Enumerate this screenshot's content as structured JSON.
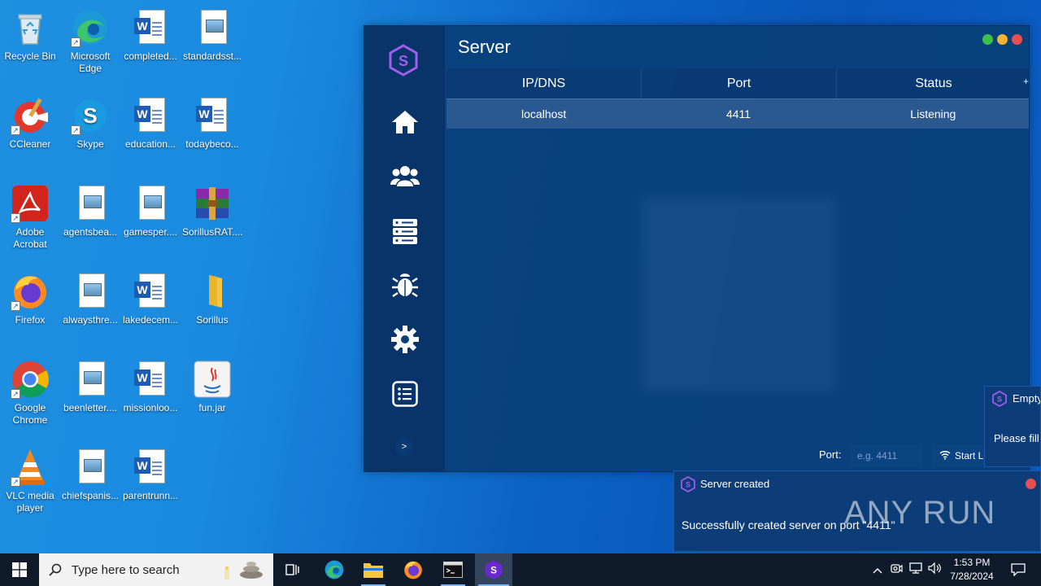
{
  "desktop": {
    "icons": [
      {
        "label": "Recycle Bin"
      },
      {
        "label": "Microsoft Edge"
      },
      {
        "label": "completed..."
      },
      {
        "label": "standardsst..."
      },
      {
        "label": "CCleaner"
      },
      {
        "label": "Skype"
      },
      {
        "label": "education..."
      },
      {
        "label": "todaybeco..."
      },
      {
        "label": "Adobe Acrobat"
      },
      {
        "label": "agentsbea..."
      },
      {
        "label": "gamesper...."
      },
      {
        "label": "SorillusRAT...."
      },
      {
        "label": "Firefox"
      },
      {
        "label": "alwaysthre..."
      },
      {
        "label": "lakedecem..."
      },
      {
        "label": "Sorillus"
      },
      {
        "label": "Google Chrome"
      },
      {
        "label": "beenletter...."
      },
      {
        "label": "missionloo..."
      },
      {
        "label": "fun.jar"
      },
      {
        "label": "VLC media player"
      },
      {
        "label": "chiefspanis..."
      },
      {
        "label": "parentrunn..."
      }
    ]
  },
  "app": {
    "title": "Server",
    "accent": "#a15cf0",
    "columns": [
      "IP/DNS",
      "Port",
      "Status"
    ],
    "add_symbol": "+",
    "rows": [
      {
        "ip": "localhost",
        "port": "4411",
        "status": "Listening"
      }
    ],
    "expand_symbol": ">",
    "port_label": "Port:",
    "port_placeholder": "e.g. 4411",
    "start_label": "Start Listening",
    "sidebar": [
      "home-icon",
      "users-icon",
      "server-icon",
      "bug-icon",
      "gear-icon",
      "list-icon"
    ]
  },
  "toasts": {
    "side": {
      "title": "Empty",
      "message": "Please fill"
    },
    "main": {
      "title": "Server created",
      "message": "Successfully created server on port \"4411\""
    }
  },
  "watermark": "ANY RUN",
  "taskbar": {
    "search_placeholder": "Type here to search",
    "time": "1:53 PM",
    "date": "7/28/2024"
  }
}
